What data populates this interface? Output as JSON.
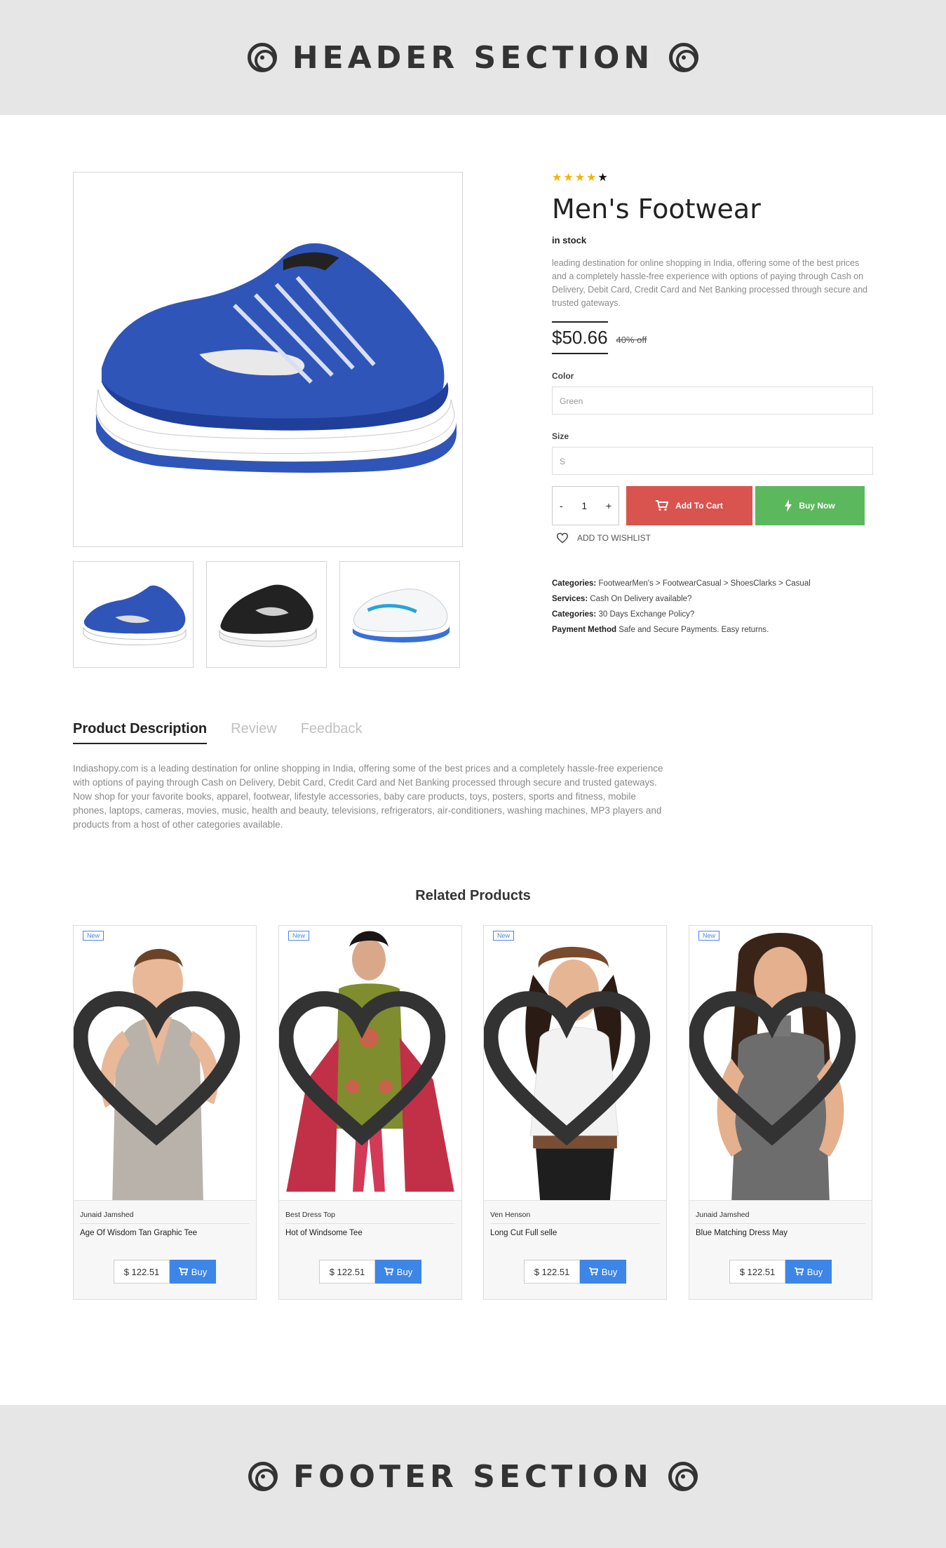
{
  "header": {
    "title": "HEADER SECTION",
    "icon": "target-icon"
  },
  "footer": {
    "title": "FOOTER SECTION",
    "icon": "target-icon"
  },
  "product": {
    "rating": 4,
    "rating_max": 5,
    "title": "Men's Footwear",
    "stock": "in stock",
    "description": "leading destination for online shopping in India, offering some of the best prices and a completely hassle-free experience with options of paying through Cash on Delivery, Debit Card, Credit Card and Net Banking processed through secure and trusted gateways.",
    "price": "$50.66",
    "discount": "40% off",
    "color_label": "Color",
    "color_value": "Green",
    "size_label": "Size",
    "size_value": "S",
    "qty_minus": "-",
    "qty_value": "1",
    "qty_plus": "+",
    "add_to_cart": "Add To Cart",
    "buy_now": "Buy Now",
    "wishlist": "ADD TO WISHLIST",
    "meta": [
      {
        "label": "Categories:",
        "value": "FootwearMen's > FootwearCasual > ShoesClarks > Casual"
      },
      {
        "label": "Services:",
        "value": "Cash On Delivery available?"
      },
      {
        "label": "Categories:",
        "value": "30 Days Exchange Policy?"
      },
      {
        "label": "Payment Method",
        "value": "Safe and Secure Payments. Easy returns."
      }
    ],
    "colors": {
      "cart": "#d9534f",
      "buy": "#5cb85c",
      "star": "#f5b301"
    }
  },
  "tabs": {
    "items": [
      "Product Description",
      "Review",
      "Feedback"
    ],
    "active": 0,
    "body": "Indiashopy.com is a leading destination for online shopping in India, offering some of the best prices and a completely hassle-free experience with options of paying through Cash on Delivery, Debit Card, Credit Card and Net Banking processed through secure and trusted gateways. Now shop for your favorite books, apparel, footwear, lifestyle accessories, baby care products, toys, posters, sports and fitness, mobile phones, laptops, cameras, movies, music, health and beauty, televisions, refrigerators, air-conditioners, washing machines, MP3 players and products from a host of other categories available."
  },
  "related": {
    "title": "Related Products",
    "items": [
      {
        "badge": "New",
        "brand": "Junaid Jamshed",
        "name": "Age Of Wisdom Tan Graphic Tee",
        "price": "$ 122.51",
        "buy": "Buy"
      },
      {
        "badge": "New",
        "brand": "Best Dress Top",
        "name": "Hot of Windsome Tee",
        "price": "$ 122.51",
        "buy": "Buy"
      },
      {
        "badge": "New",
        "brand": "Ven Henson",
        "name": "Long Cut Full selle",
        "price": "$ 122.51",
        "buy": "Buy"
      },
      {
        "badge": "New",
        "brand": "Junaid Jamshed",
        "name": "Blue Matching Dress May",
        "price": "$ 122.51",
        "buy": "Buy"
      }
    ],
    "accent": "#3d86e8"
  }
}
